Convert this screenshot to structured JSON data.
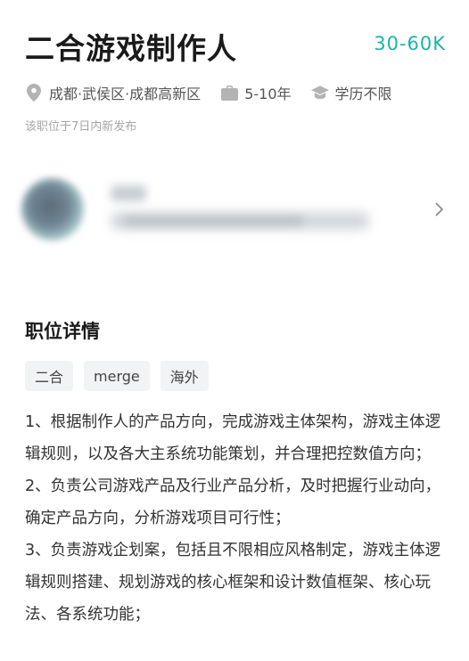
{
  "job": {
    "title": "二合游戏制作人",
    "salary": "30-60K"
  },
  "meta": {
    "location": "成都·武侯区·成都高新区",
    "experience": "5-10年",
    "education": "学历不限"
  },
  "posted": "该职位于7日内新发布",
  "section": {
    "title": "职位详情"
  },
  "tags": [
    "二合",
    "merge",
    "海外"
  ],
  "description": [
    "1、根据制作人的产品方向，完成游戏主体架构，游戏主体逻辑规则，以及各大主系统功能策划，并合理把控数值方向；",
    "2、负责公司游戏产品及行业产品分析，及时把握行业动向，确定产品方向，分析游戏项目可行性；",
    "3、负责游戏企划案，包括且不限相应风格制定，游戏主体逻辑规则搭建、规划游戏的核心框架和设计数值框架、核心玩法、各系统功能；"
  ],
  "colors": {
    "salary": "#1fb3a4",
    "tag_bg": "#f2f3f5",
    "muted": "#a6a6a6"
  },
  "icons": {
    "location": "location-pin-icon",
    "experience": "briefcase-icon",
    "education": "graduation-cap-icon",
    "more": "chevron-right-icon"
  }
}
